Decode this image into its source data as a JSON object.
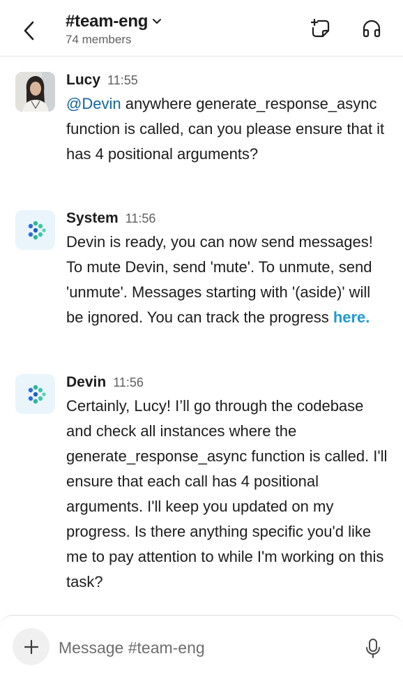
{
  "header": {
    "channel_title": "#team-eng",
    "members": "74 members",
    "icons": {
      "back": "chevron-left-icon",
      "dropdown": "chevron-down-icon",
      "canvas": "canvas-add-icon",
      "huddle": "headphones-icon"
    }
  },
  "messages": [
    {
      "author": "Lucy",
      "time": "11:55",
      "mention": "@Devin",
      "text": " anywhere generate_response_async function is called, can you please ensure that it has 4 positional arguments?"
    },
    {
      "author": "System",
      "time": "11:56",
      "text": "Devin is ready, you can now send messages! To mute Devin, send 'mute'. To unmute, send 'unmute'. Messages starting with '(aside)' will be ignored. You can track the progress ",
      "link_text": "here."
    },
    {
      "author": "Devin",
      "time": "11:56",
      "text": "Certainly, Lucy! I’ll go through the codebase and check all instances where the generate_response_async function is called. I'll ensure that each call has 4 positional arguments. I'll keep you updated on my progress. Is there anything specific you'd like me to pay attention to while I'm working on this task?"
    }
  ],
  "composer": {
    "placeholder": "Message #team-eng",
    "icons": {
      "add": "plus-icon",
      "voice": "microphone-icon"
    }
  },
  "colors": {
    "mention": "#1264a3",
    "link": "#1d9bd1",
    "bot_avatar_bg": "#eaf4fb"
  }
}
